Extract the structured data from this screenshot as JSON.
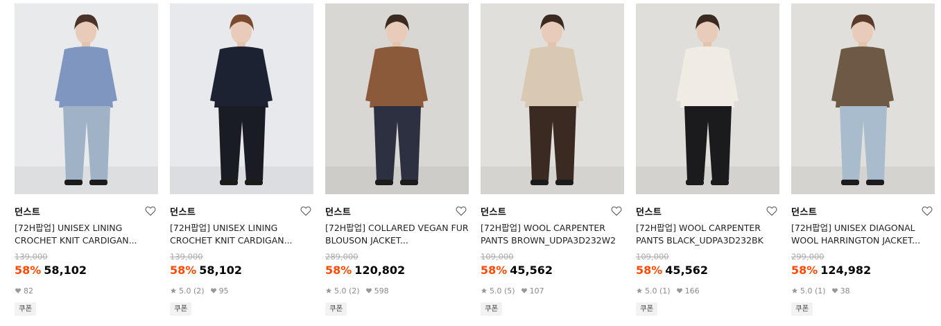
{
  "products": [
    {
      "brand": "던스트",
      "name": "[72H팝업] UNISEX LINING CROCHET KNIT CARDIGAN...",
      "original_price": "139,000",
      "discount": "58%",
      "price": "58,102",
      "rating": "",
      "likes": "82",
      "coupon": "쿠폰",
      "colors": {
        "bg": "#e9eaec",
        "top": "#7f97c0",
        "bottom": "#9fb2c6",
        "hair": "#4a3328"
      }
    },
    {
      "brand": "던스트",
      "name": "[72H팝업] UNISEX LINING CROCHET KNIT CARDIGAN...",
      "original_price": "139,000",
      "discount": "58%",
      "price": "58,102",
      "rating": "5.0 (2)",
      "likes": "95",
      "coupon": "쿠폰",
      "colors": {
        "bg": "#e8e9ec",
        "top": "#1d2233",
        "bottom": "#1a1c24",
        "hair": "#7a4a2e"
      }
    },
    {
      "brand": "던스트",
      "name": "[72H팝업] COLLARED VEGAN FUR BLOUSON JACKET...",
      "original_price": "289,000",
      "discount": "58%",
      "price": "120,802",
      "rating": "5.0 (2)",
      "likes": "598",
      "coupon": "쿠폰",
      "colors": {
        "bg": "#d9d7d4",
        "top": "#8a5a3a",
        "bottom": "#2c3040",
        "hair": "#3b2a22"
      }
    },
    {
      "brand": "던스트",
      "name": "[72H팝업] WOOL CARPENTER PANTS BROWN_UDPA3D232W2",
      "original_price": "109,000",
      "discount": "58%",
      "price": "45,562",
      "rating": "5.0 (5)",
      "likes": "107",
      "coupon": "쿠폰",
      "colors": {
        "bg": "#e0dfdc",
        "top": "#d9c8b2",
        "bottom": "#3a2a22",
        "hair": "#3b2a22"
      }
    },
    {
      "brand": "던스트",
      "name": "[72H팝업] WOOL CARPENTER PANTS BLACK_UDPA3D232BK",
      "original_price": "109,000",
      "discount": "58%",
      "price": "45,562",
      "rating": "5.0 (1)",
      "likes": "166",
      "coupon": "쿠폰",
      "colors": {
        "bg": "#dfdedb",
        "top": "#f1ece3",
        "bottom": "#1b1b1d",
        "hair": "#3b2a22"
      }
    },
    {
      "brand": "던스트",
      "name": "[72H팝업] UNISEX DIAGONAL WOOL HARRINGTON JACKET...",
      "original_price": "299,000",
      "discount": "58%",
      "price": "124,982",
      "rating": "5.0 (1)",
      "likes": "38",
      "coupon": "쿠폰",
      "colors": {
        "bg": "#e1dfdb",
        "top": "#6e5a44",
        "bottom": "#a9bccd",
        "hair": "#5a3a2a"
      }
    }
  ],
  "icons": {
    "wishlist": "heart-outline-icon",
    "rating": "star-icon",
    "likes": "heart-filled-icon"
  },
  "accent_color": "#ff4800"
}
